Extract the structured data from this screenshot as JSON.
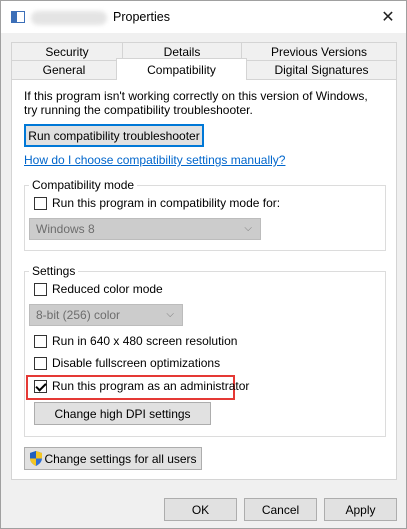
{
  "window": {
    "title": "Properties",
    "close_glyph": "✕"
  },
  "tabs": {
    "row1": [
      "Security",
      "Details",
      "Previous Versions"
    ],
    "row2": [
      "General",
      "Compatibility",
      "Digital Signatures"
    ],
    "active": "Compatibility"
  },
  "intro": {
    "line1": "If this program isn't working correctly on this version of Windows,",
    "line2": "try running the compatibility troubleshooter."
  },
  "troubleshooter_button": "Run compatibility troubleshooter",
  "manual_link": "How do I choose compatibility settings manually?",
  "compat_mode": {
    "group_label": "Compatibility mode",
    "checkbox_label": "Run this program in compatibility mode for:",
    "checked": false,
    "os_select": "Windows 8"
  },
  "settings": {
    "group_label": "Settings",
    "reduced_color": {
      "label": "Reduced color mode",
      "checked": false
    },
    "color_select": "8-bit (256) color",
    "run_640": {
      "label": "Run in 640 x 480 screen resolution",
      "checked": false
    },
    "disable_fullscreen": {
      "label": "Disable fullscreen optimizations",
      "checked": false
    },
    "run_admin": {
      "label": "Run this program as an administrator",
      "checked": true
    },
    "dpi_button": "Change high DPI settings"
  },
  "all_users_button": "Change settings for all users",
  "footer": {
    "ok": "OK",
    "cancel": "Cancel",
    "apply": "Apply"
  },
  "colors": {
    "highlight": "#e53935",
    "link": "#0066cc",
    "focus": "#0078d7"
  }
}
